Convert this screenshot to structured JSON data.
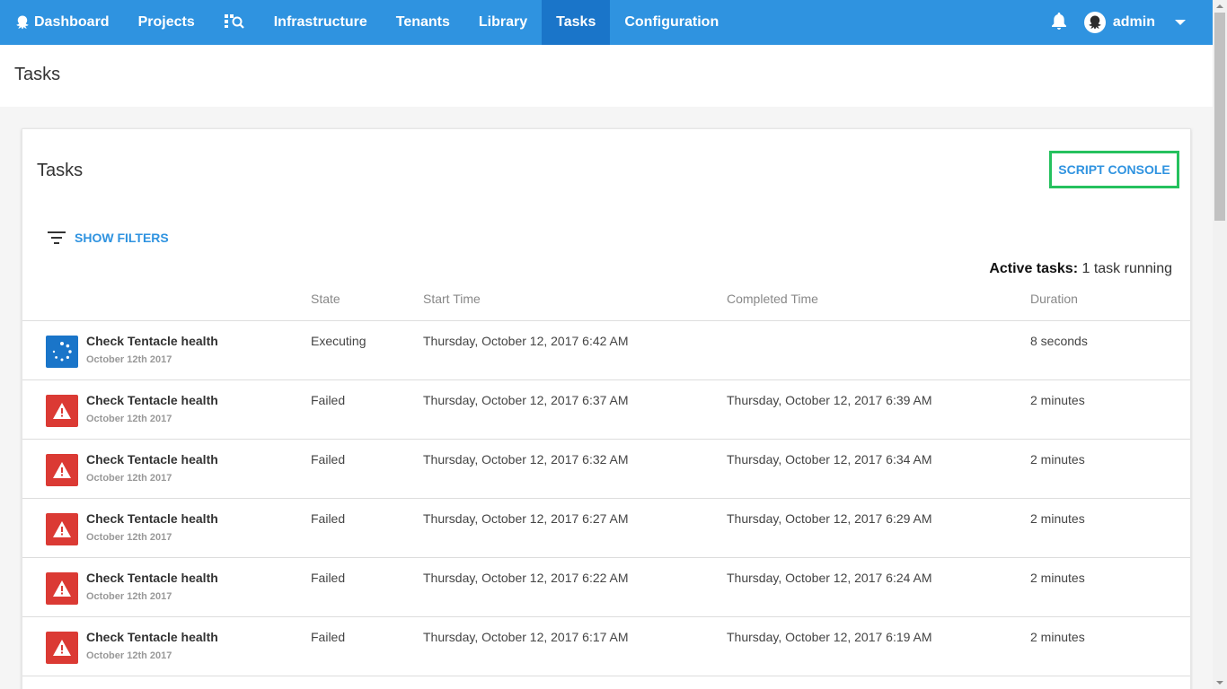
{
  "nav": {
    "items": [
      {
        "label": "Dashboard",
        "icon": "octopus-icon"
      },
      {
        "label": "Projects"
      },
      {
        "label": "",
        "icon": "search-resources-icon"
      },
      {
        "label": "Infrastructure"
      },
      {
        "label": "Tenants"
      },
      {
        "label": "Library"
      },
      {
        "label": "Tasks",
        "active": true
      },
      {
        "label": "Configuration"
      }
    ],
    "user": "admin"
  },
  "page": {
    "title": "Tasks"
  },
  "card": {
    "title": "Tasks",
    "script_console": "SCRIPT CONSOLE",
    "show_filters": "SHOW FILTERS",
    "active_label": "Active tasks:",
    "active_value": "1 task running"
  },
  "table": {
    "headers": [
      "State",
      "Start Time",
      "Completed Time",
      "Duration"
    ],
    "rows": [
      {
        "name": "Check Tentacle health",
        "date": "October 12th 2017",
        "state": "Executing",
        "start": "Thursday, October 12, 2017 6:42 AM",
        "completed": "",
        "duration": "8 seconds",
        "status": "executing"
      },
      {
        "name": "Check Tentacle health",
        "date": "October 12th 2017",
        "state": "Failed",
        "start": "Thursday, October 12, 2017 6:37 AM",
        "completed": "Thursday, October 12, 2017 6:39 AM",
        "duration": "2 minutes",
        "status": "failed"
      },
      {
        "name": "Check Tentacle health",
        "date": "October 12th 2017",
        "state": "Failed",
        "start": "Thursday, October 12, 2017 6:32 AM",
        "completed": "Thursday, October 12, 2017 6:34 AM",
        "duration": "2 minutes",
        "status": "failed"
      },
      {
        "name": "Check Tentacle health",
        "date": "October 12th 2017",
        "state": "Failed",
        "start": "Thursday, October 12, 2017 6:27 AM",
        "completed": "Thursday, October 12, 2017 6:29 AM",
        "duration": "2 minutes",
        "status": "failed"
      },
      {
        "name": "Check Tentacle health",
        "date": "October 12th 2017",
        "state": "Failed",
        "start": "Thursday, October 12, 2017 6:22 AM",
        "completed": "Thursday, October 12, 2017 6:24 AM",
        "duration": "2 minutes",
        "status": "failed"
      },
      {
        "name": "Check Tentacle health",
        "date": "October 12th 2017",
        "state": "Failed",
        "start": "Thursday, October 12, 2017 6:17 AM",
        "completed": "Thursday, October 12, 2017 6:19 AM",
        "duration": "2 minutes",
        "status": "failed"
      }
    ]
  },
  "colors": {
    "nav_bg": "#2f93e0",
    "nav_active": "#1a75c9",
    "failed": "#db3a34",
    "executing": "#1a75c9",
    "highlight": "#25c15e"
  }
}
